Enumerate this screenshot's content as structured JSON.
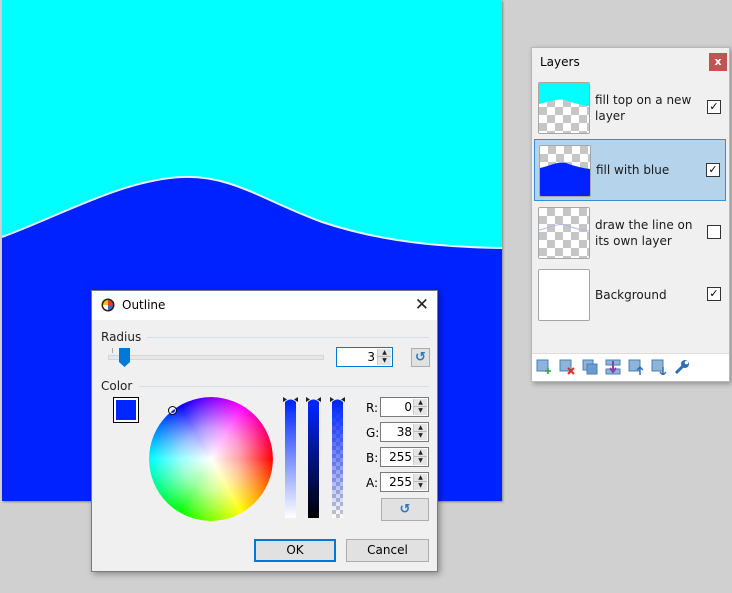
{
  "canvas": {
    "top_color": "#00ffff",
    "bottom_color": "#0022ff",
    "line_color": "#e8f2ff"
  },
  "layers_panel": {
    "title": "Layers",
    "close_label": "x",
    "layers": [
      {
        "name": "fill top on a new layer",
        "visible": true,
        "selected": false,
        "thumb": "cyan-top"
      },
      {
        "name": "fill with blue",
        "visible": true,
        "selected": true,
        "thumb": "blue-bottom"
      },
      {
        "name": "draw the line on its own layer",
        "visible": false,
        "selected": false,
        "thumb": "line"
      },
      {
        "name": "Background",
        "visible": true,
        "selected": false,
        "thumb": "white"
      }
    ],
    "toolbar": [
      {
        "icon": "add-layer-icon",
        "tooltip": "Add New Layer"
      },
      {
        "icon": "delete-layer-icon",
        "tooltip": "Delete Layer"
      },
      {
        "icon": "duplicate-layer-icon",
        "tooltip": "Duplicate Layer"
      },
      {
        "icon": "merge-layer-down-icon",
        "tooltip": "Merge Layer Down"
      },
      {
        "icon": "move-layer-up-icon",
        "tooltip": "Move Layer Up"
      },
      {
        "icon": "move-layer-down-icon",
        "tooltip": "Move Layer Down"
      },
      {
        "icon": "layer-properties-icon",
        "tooltip": "Layer Properties"
      }
    ]
  },
  "dialog": {
    "title": "Outline",
    "close_label": "✕",
    "radius_label": "Radius",
    "radius_value": "3",
    "radius_slider_fraction": 0.03,
    "color_label": "Color",
    "color_hex": "#0026ff",
    "rgba": [
      {
        "label": "R:",
        "value": "0"
      },
      {
        "label": "G:",
        "value": "38"
      },
      {
        "label": "B:",
        "value": "255"
      },
      {
        "label": "A:",
        "value": "255"
      }
    ],
    "reset_glyph": "↺",
    "ok_label": "OK",
    "cancel_label": "Cancel"
  }
}
